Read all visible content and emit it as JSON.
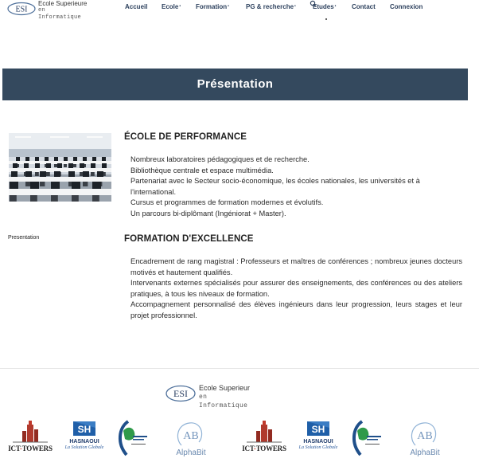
{
  "header": {
    "logo": {
      "mark": "ESI",
      "line1": "Ecole Superieure",
      "line2": "en Informatique"
    },
    "nav": [
      {
        "label": "Accueil",
        "dropdown": false
      },
      {
        "label": "Ecole",
        "dropdown": true
      },
      {
        "label": "Formation",
        "dropdown": true
      },
      {
        "label": "PG & recherche",
        "dropdown": true
      },
      {
        "label": "Etudes",
        "dropdown": true
      },
      {
        "label": "Contact",
        "dropdown": false
      },
      {
        "label": "Connexion",
        "dropdown": false
      }
    ],
    "search_icon": "search-icon",
    "caret": "•"
  },
  "banner": {
    "title": "Présentation"
  },
  "sidebar": {
    "label": "Presentation",
    "image": "computer-lab-photo"
  },
  "sections": [
    {
      "title": "ÉCOLE DE PERFORMANCE",
      "items": [
        "Nombreux laboratoires pédagogiques et de recherche.",
        "Bibliothèque centrale et espace multimédia.",
        "Partenariat avec le Secteur socio-économique, les écoles nationales, les universités et à l'international.",
        "Cursus et programmes de formation modernes et évolutifs.",
        "Un parcours bi-diplômant (Ingéniorat + Master)."
      ]
    },
    {
      "title": "FORMATION D'EXCELLENCE",
      "items": [
        "Encadrement de rang magistral : Professeurs et maîtres de conférences ; nombreux jeunes docteurs motivés et hautement qualifiés.",
        "Intervenants externes spécialisés pour assurer des enseignements, des conférences ou des ateliers pratiques, à tous les niveaux de formation.",
        "Accompagnement personnalisé des élèves ingénieurs dans leur progression, leurs stages et leur projet professionnel."
      ]
    }
  ],
  "footer": {
    "logo": {
      "mark": "ESI",
      "line1": "Ecole Superieur",
      "line2": "en Informatique"
    },
    "partners": [
      {
        "name": "ICT-TOWERS",
        "icon": "ict-towers-logo",
        "text_left": "ICT",
        "text_dash": "-",
        "text_right": "TOWERS"
      },
      {
        "name": "HASNAOUI",
        "icon": "hasnaoui-logo",
        "mark": "SH",
        "text": "HASNAOUI",
        "tagline": "La Solution Globale"
      },
      {
        "name": "Algérie Télécom",
        "icon": "algerie-telecom-logo"
      },
      {
        "name": "AlphaBit",
        "icon": "alphabit-logo",
        "mark": "AB",
        "text": "AlphaBit"
      }
    ]
  },
  "colors": {
    "banner": "#34495e",
    "nav_text": "#2b3f5c",
    "brand_blue": "#2a5a9e",
    "ict_red": "#c0392b"
  }
}
